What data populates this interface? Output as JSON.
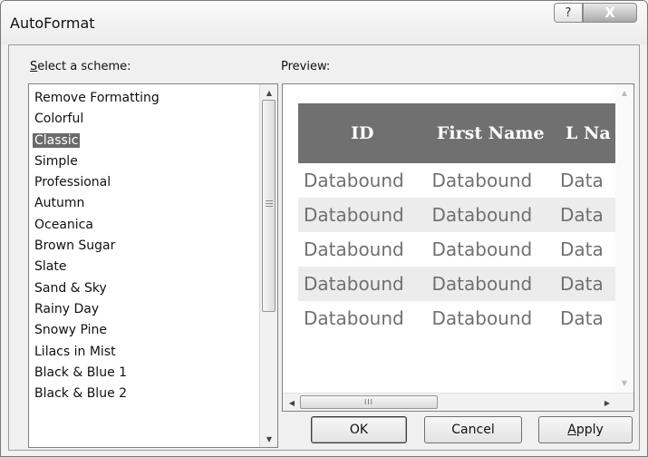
{
  "window": {
    "title": "AutoFormat",
    "help_glyph": "?",
    "close_glyph": "X"
  },
  "scheme_label": "Select a scheme:",
  "scheme_label_access": "S",
  "scheme_label_rest": "elect a scheme:",
  "schemes": {
    "selected": "Classic",
    "items": [
      "Remove Formatting",
      "Colorful",
      "Classic",
      "Simple",
      "Professional",
      "Autumn",
      "Oceanica",
      "Brown Sugar",
      "Slate",
      "Sand & Sky",
      "Rainy Day",
      "Snowy Pine",
      "Lilacs in Mist",
      "Black & Blue 1",
      "Black & Blue 2"
    ]
  },
  "preview": {
    "label": "Preview:",
    "columns": [
      "ID",
      "First Name",
      "L Na"
    ],
    "rows": [
      [
        "Databound",
        "Databound",
        "Data"
      ],
      [
        "Databound",
        "Databound",
        "Data"
      ],
      [
        "Databound",
        "Databound",
        "Data"
      ],
      [
        "Databound",
        "Databound",
        "Data"
      ],
      [
        "Databound",
        "Databound",
        "Data"
      ]
    ],
    "header_color": "#707070",
    "alt_row_color": "#ececec",
    "text_color": "#707070"
  },
  "buttons": {
    "ok": "OK",
    "cancel": "Cancel",
    "apply": "Apply",
    "apply_access": "A",
    "apply_rest": "pply"
  },
  "scroll_icons": {
    "up": "▲",
    "down": "▼",
    "left": "◀",
    "right": "▶",
    "grip": "III"
  }
}
